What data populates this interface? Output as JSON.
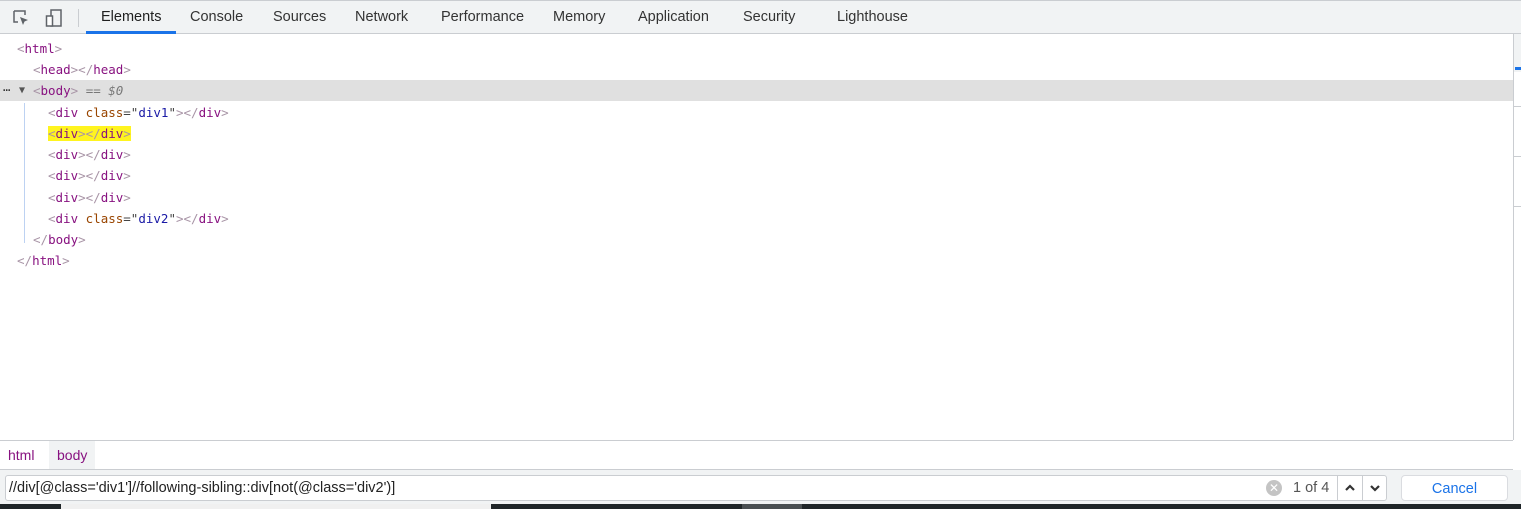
{
  "toolbar": {
    "icons": [
      "inspect-element-icon",
      "device-toolbar-icon"
    ],
    "tabs": [
      {
        "label": "Elements",
        "active": true
      },
      {
        "label": "Console"
      },
      {
        "label": "Sources"
      },
      {
        "label": "Network"
      },
      {
        "label": "Performance"
      },
      {
        "label": "Memory"
      },
      {
        "label": "Application"
      },
      {
        "label": "Security"
      },
      {
        "label": "Lighthouse"
      }
    ]
  },
  "dom_tree": {
    "lines": [
      {
        "open": "html"
      },
      {
        "open": "head",
        "close": "head"
      },
      {
        "open": "body",
        "selected": true,
        "marker": "== $0",
        "dots": "⋯",
        "arrow": "▼"
      },
      {
        "open": "div",
        "attr_name": "class",
        "attr_value": "div1",
        "close": "div"
      },
      {
        "open": "div",
        "close": "div",
        "highlighted": true
      },
      {
        "open": "div",
        "close": "div"
      },
      {
        "open": "div",
        "close": "div"
      },
      {
        "open": "div",
        "close": "div"
      },
      {
        "open": "div",
        "attr_name": "class",
        "attr_value": "div2",
        "close": "div"
      },
      {
        "close": "body"
      },
      {
        "close": "html"
      }
    ]
  },
  "breadcrumbs": [
    {
      "label": "html"
    },
    {
      "label": "body",
      "active": true
    }
  ],
  "search": {
    "value": "//div[@class='div1']//following-sibling::div[not(@class='div2')]",
    "match_count": "1 of 4",
    "clear_icon": "✕",
    "prev_icon": "chevron-up-icon",
    "next_icon": "chevron-down-icon",
    "cancel_label": "Cancel"
  },
  "colors": {
    "accent": "#1a73e8",
    "tag": "#881280",
    "attr_name": "#994500",
    "attr_value": "#1a1aa6",
    "highlight": "#fff41f",
    "selected_row": "#e0e0e0"
  }
}
